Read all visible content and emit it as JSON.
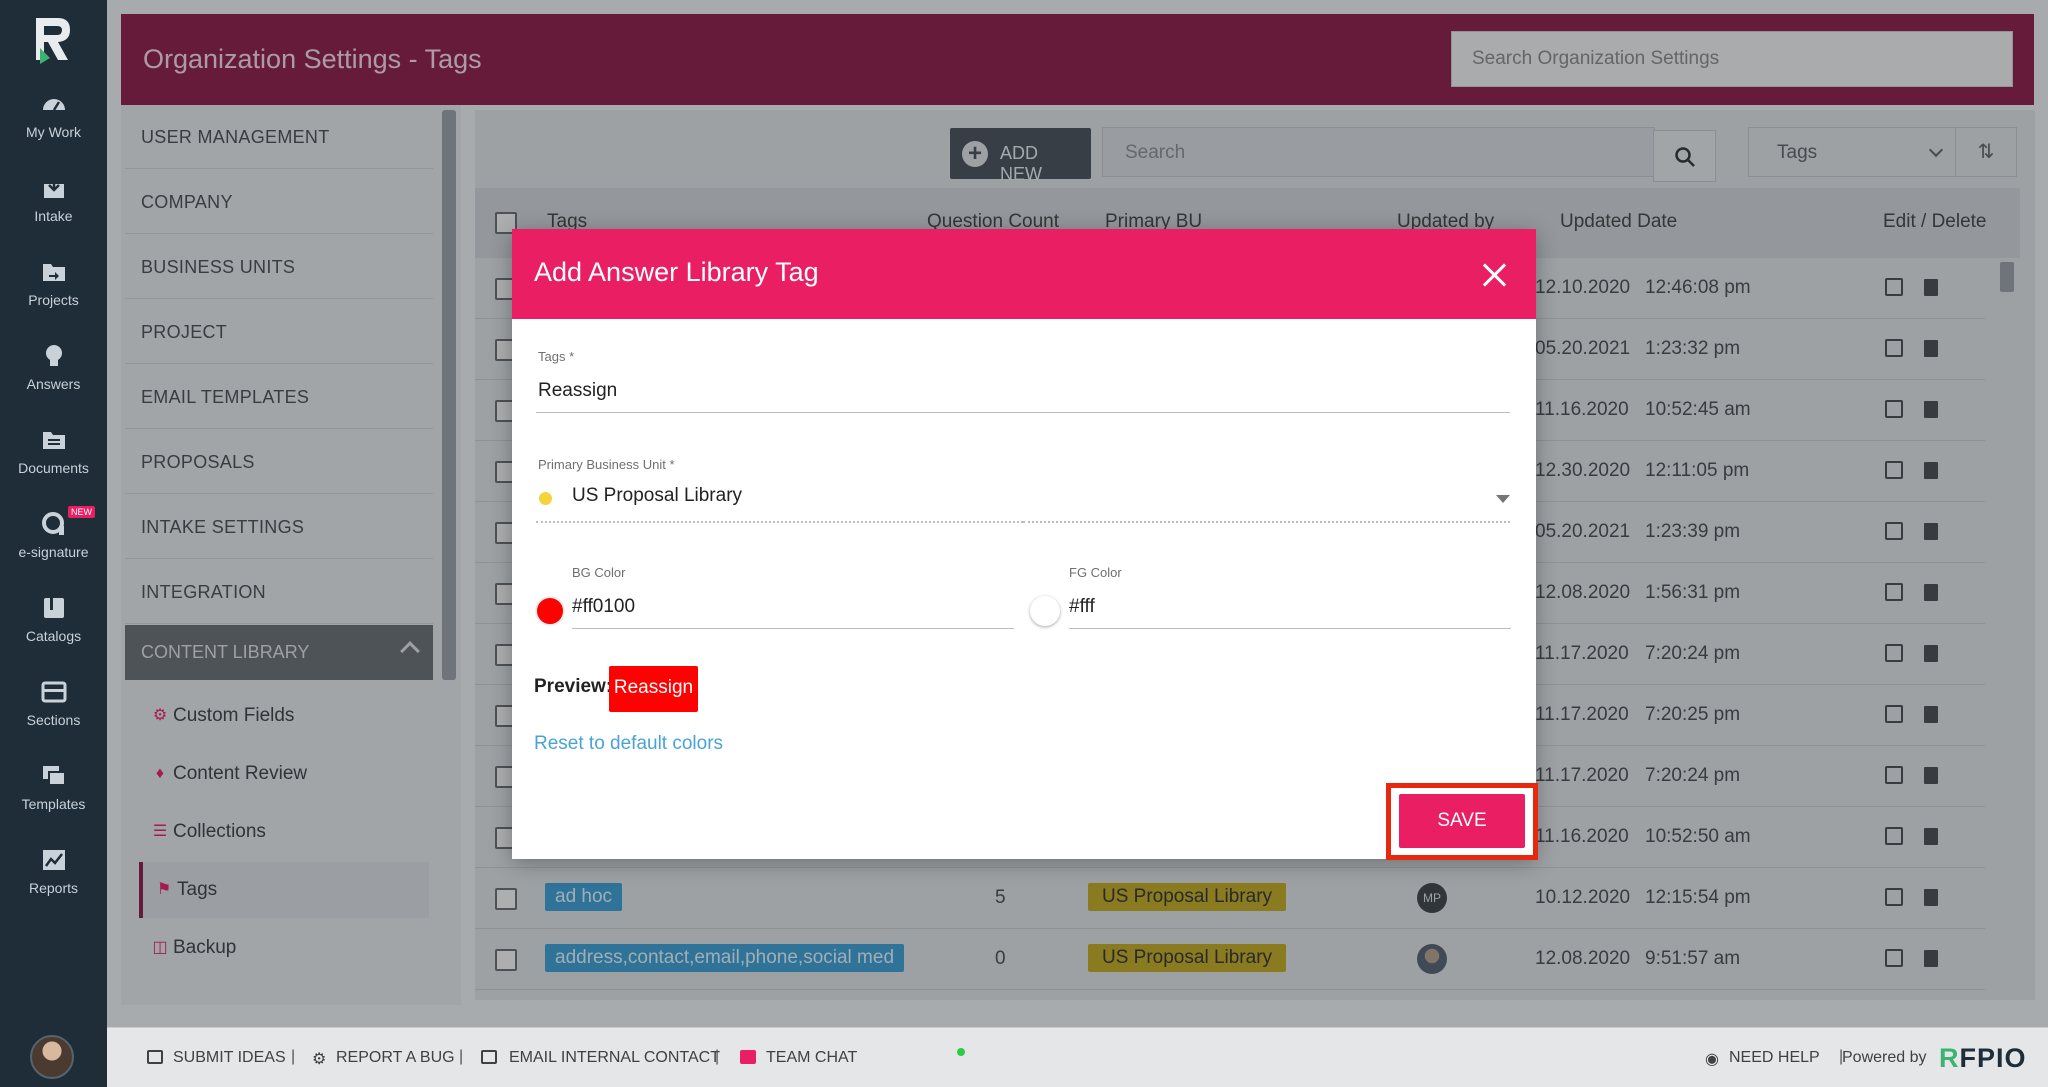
{
  "rail": {
    "items": [
      {
        "label": "My Work",
        "icon": "dashboard-icon"
      },
      {
        "label": "Intake",
        "icon": "intake-icon"
      },
      {
        "label": "Projects",
        "icon": "projects-icon"
      },
      {
        "label": "Answers",
        "icon": "lightbulb-icon"
      },
      {
        "label": "Documents",
        "icon": "folder-icon"
      },
      {
        "label": "e-signature",
        "icon": "signature-icon"
      },
      {
        "label": "Catalogs",
        "icon": "book-icon"
      },
      {
        "label": "Sections",
        "icon": "sections-icon"
      },
      {
        "label": "Templates",
        "icon": "templates-icon"
      },
      {
        "label": "Reports",
        "icon": "chart-icon"
      }
    ],
    "new_badge": "NEW"
  },
  "header": {
    "title": "Organization Settings - Tags",
    "search_placeholder": "Search Organization Settings"
  },
  "sidebar": {
    "items": [
      "USER MANAGEMENT",
      "COMPANY",
      "BUSINESS UNITS",
      "PROJECT",
      "EMAIL TEMPLATES",
      "PROPOSALS",
      "INTAKE SETTINGS",
      "INTEGRATION"
    ],
    "active_section": "CONTENT LIBRARY",
    "sub_items": [
      {
        "label": "Custom Fields",
        "icon": "gear-icon"
      },
      {
        "label": "Content Review",
        "icon": "bell-icon"
      },
      {
        "label": "Collections",
        "icon": "list-icon"
      },
      {
        "label": "Tags",
        "icon": "tag-icon"
      },
      {
        "label": "Backup",
        "icon": "database-icon"
      }
    ]
  },
  "toolbar": {
    "add_new": "ADD NEW",
    "search_placeholder": "Search",
    "filter_value": "Tags"
  },
  "table": {
    "headers": {
      "tags": "Tags",
      "question_count": "Question Count",
      "primary_bu": "Primary BU",
      "updated_by": "Updated by",
      "updated_date": "Updated Date",
      "edit_delete": "Edit / Delete"
    },
    "rows": [
      {
        "date": "12.10.2020",
        "time": "12:46:08 pm"
      },
      {
        "date": "05.20.2021",
        "time": "1:23:32 pm"
      },
      {
        "date": "11.16.2020",
        "time": "10:52:45 am"
      },
      {
        "date": "12.30.2020",
        "time": "12:11:05 pm"
      },
      {
        "date": "05.20.2021",
        "time": "1:23:39 pm"
      },
      {
        "date": "12.08.2020",
        "time": "1:56:31 pm"
      },
      {
        "date": "11.17.2020",
        "time": "7:20:24 pm"
      },
      {
        "date": "11.17.2020",
        "time": "7:20:25 pm"
      },
      {
        "date": "11.17.2020",
        "time": "7:20:24 pm"
      },
      {
        "date": "11.16.2020",
        "time": "10:52:50 am"
      },
      {
        "tag": "ad hoc",
        "count": "5",
        "bu": "US Proposal Library",
        "user": "MP",
        "date": "10.12.2020",
        "time": "12:15:54 pm"
      },
      {
        "tag": "address,contact,email,phone,social med",
        "count": "0",
        "bu": "US Proposal Library",
        "user": "",
        "date": "12.08.2020",
        "time": "9:51:57 am"
      }
    ]
  },
  "modal": {
    "title": "Add Answer Library Tag",
    "tags_label": "Tags *",
    "tags_value": "Reassign",
    "bu_label": "Primary Business Unit *",
    "bu_value": "US Proposal Library",
    "bg_label": "BG Color",
    "bg_value": "#ff0100",
    "fg_label": "FG Color",
    "fg_value": "#fff",
    "preview_label": "Preview:",
    "preview_text": "Reassign",
    "reset_link": "Reset to default colors",
    "save": "SAVE"
  },
  "footer": {
    "submit_ideas": "SUBMIT IDEAS",
    "report_bug": "REPORT A BUG",
    "email_contact": "EMAIL INTERNAL CONTACT",
    "team_chat": "TEAM CHAT",
    "need_help": "NEED HELP",
    "powered_by": "Powered by",
    "brand_r": "R",
    "brand_rest": "FPIO"
  },
  "colors": {
    "header": "#8e1c49",
    "accent": "#e91e63",
    "rail": "#1f2d38",
    "tag_chip": "#3d9fd2",
    "bu_chip": "#c3a821",
    "highlight": "#e8270f"
  }
}
